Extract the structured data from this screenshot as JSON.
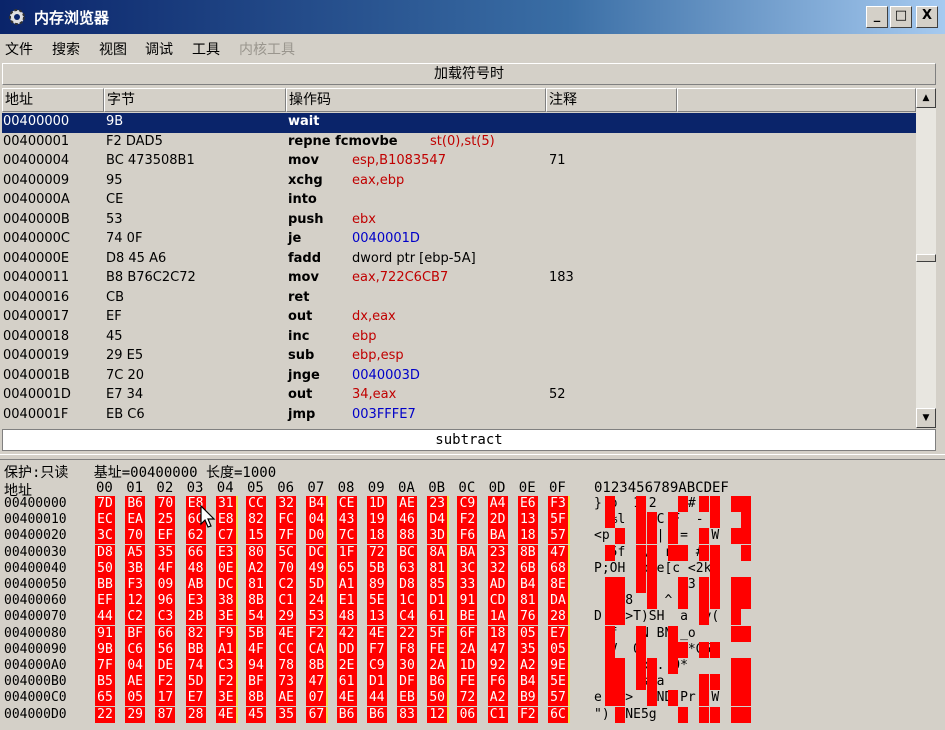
{
  "window": {
    "title": "内存浏览器",
    "min_label": "_",
    "max_label": "□",
    "close_label": "X"
  },
  "menu": [
    "文件",
    "搜索",
    "视图",
    "调试",
    "工具",
    "内核工具"
  ],
  "load_symbols_label": "加载符号时",
  "columns": [
    "地址",
    "字节",
    "操作码",
    "注释"
  ],
  "disasm": [
    {
      "addr": "00400000",
      "bytes": "9B",
      "op": "wait",
      "args": "",
      "cmt": "",
      "selected": true
    },
    {
      "addr": "00400001",
      "bytes": "F2 DAD5",
      "op": "repne fcmovbe",
      "args": "st(0),st(5)",
      "cmt": ""
    },
    {
      "addr": "00400004",
      "bytes": "BC 473508B1",
      "op": "mov",
      "args": "esp,B1083547",
      "cmt": "71"
    },
    {
      "addr": "00400009",
      "bytes": "95",
      "op": "xchg",
      "args": "eax,ebp",
      "cmt": ""
    },
    {
      "addr": "0040000A",
      "bytes": "CE",
      "op": "into",
      "args": "",
      "cmt": ""
    },
    {
      "addr": "0040000B",
      "bytes": "53",
      "op": "push",
      "args": "ebx",
      "cmt": ""
    },
    {
      "addr": "0040000C",
      "bytes": "74 0F",
      "op": "je",
      "args": "0040001D",
      "cmt": ""
    },
    {
      "addr": "0040000E",
      "bytes": "D8 45 A6",
      "op": "fadd",
      "args": "dword ptr [ebp-5A]",
      "cmt": ""
    },
    {
      "addr": "00400011",
      "bytes": "B8 B76C2C72",
      "op": "mov",
      "args": "eax,722C6CB7",
      "cmt": "183"
    },
    {
      "addr": "00400016",
      "bytes": "CB",
      "op": "ret",
      "args": "",
      "cmt": ""
    },
    {
      "addr": "00400017",
      "bytes": "EF",
      "op": "out",
      "args": "dx,eax",
      "cmt": ""
    },
    {
      "addr": "00400018",
      "bytes": "45",
      "op": "inc",
      "args": "ebp",
      "cmt": ""
    },
    {
      "addr": "00400019",
      "bytes": "29 E5",
      "op": "sub",
      "args": "ebp,esp",
      "cmt": ""
    },
    {
      "addr": "0040001B",
      "bytes": "7C 20",
      "op": "jnge",
      "args": "0040003D",
      "cmt": ""
    },
    {
      "addr": "0040001D",
      "bytes": "E7 34",
      "op": "out",
      "args": "34,eax",
      "cmt": "52"
    },
    {
      "addr": "0040001F",
      "bytes": "EB C6",
      "op": "jmp",
      "args": "003FFFE7",
      "cmt": ""
    }
  ],
  "subtract_label": "subtract",
  "hex_info": "保护:只读   基址=00400000 长度=1000",
  "hex_addr_label": "地址",
  "hex_cols": [
    "00",
    "01",
    "02",
    "03",
    "04",
    "05",
    "06",
    "07",
    "08",
    "09",
    "0A",
    "0B",
    "0C",
    "0D",
    "0E",
    "0F"
  ],
  "hex_ascii_header": "0123456789ABCDEF",
  "hex_rows": [
    {
      "addr": "00400000",
      "bytes": [
        "7D",
        "B6",
        "70",
        "E8",
        "31",
        "CC",
        "32",
        "B4",
        "CE",
        "1D",
        "AE",
        "23",
        "C9",
        "A4",
        "E6",
        "F3"
      ],
      "ascii": "} p  1 2    #    "
    },
    {
      "addr": "00400010",
      "bytes": [
        "EC",
        "EA",
        "25",
        "6C",
        "E8",
        "82",
        "FC",
        "04",
        "43",
        "19",
        "46",
        "D4",
        "F2",
        "2D",
        "13",
        "5F"
      ],
      "ascii": "  %l    C F  -  "
    },
    {
      "addr": "00400020",
      "bytes": [
        "3C",
        "70",
        "EF",
        "62",
        "C7",
        "15",
        "7F",
        "D0",
        "7C",
        "18",
        "88",
        "3D",
        "F6",
        "BA",
        "18",
        "57"
      ],
      "ascii": "<p b    |  =   W"
    },
    {
      "addr": "00400030",
      "bytes": [
        "D8",
        "A5",
        "35",
        "66",
        "E3",
        "80",
        "5C",
        "DC",
        "1F",
        "72",
        "BC",
        "8A",
        "BA",
        "23",
        "8B",
        "47"
      ],
      "ascii": "  5f  \\  r   # G"
    },
    {
      "addr": "00400040",
      "bytes": [
        "50",
        "3B",
        "4F",
        "48",
        "0E",
        "A2",
        "70",
        "49",
        "65",
        "5B",
        "63",
        "81",
        "3C",
        "32",
        "6B",
        "68"
      ],
      "ascii": "P;OH  pIe[c <2kh"
    },
    {
      "addr": "00400050",
      "bytes": [
        "BB",
        "F3",
        "09",
        "AB",
        "DC",
        "81",
        "C2",
        "5D",
        "A1",
        "89",
        "D8",
        "85",
        "33",
        "AD",
        "B4",
        "8E"
      ],
      "ascii": "       ]    3   "
    },
    {
      "addr": "00400060",
      "bytes": [
        "EF",
        "12",
        "96",
        "E3",
        "38",
        "8B",
        "C1",
        "24",
        "E1",
        "5E",
        "1C",
        "D1",
        "91",
        "CD",
        "81",
        "DA"
      ],
      "ascii": "    8  $ ^      "
    },
    {
      "addr": "00400070",
      "bytes": [
        "44",
        "C2",
        "C3",
        "2B",
        "3E",
        "54",
        "29",
        "53",
        "48",
        "13",
        "C4",
        "61",
        "BE",
        "1A",
        "76",
        "28"
      ],
      "ascii": "D  +>T)SH  a  v("
    },
    {
      "addr": "00400080",
      "bytes": [
        "91",
        "BF",
        "66",
        "82",
        "F9",
        "5B",
        "4E",
        "F2",
        "42",
        "4E",
        "22",
        "5F",
        "6F",
        "18",
        "05",
        "E7"
      ],
      "ascii": "  f  [N BN\"_o   "
    },
    {
      "addr": "00400090",
      "bytes": [
        "9B",
        "C6",
        "56",
        "BB",
        "A1",
        "4F",
        "CC",
        "CA",
        "DD",
        "F7",
        "F8",
        "FE",
        "2A",
        "47",
        "35",
        "05"
      ],
      "ascii": "  V  O      *G5 "
    },
    {
      "addr": "004000A0",
      "bytes": [
        "7F",
        "04",
        "DE",
        "74",
        "C3",
        "94",
        "78",
        "8B",
        "2E",
        "C9",
        "30",
        "2A",
        "1D",
        "92",
        "A2",
        "9E"
      ],
      "ascii": "   t  x . 0*    "
    },
    {
      "addr": "004000B0",
      "bytes": [
        "B5",
        "AE",
        "F2",
        "5D",
        "F2",
        "BF",
        "73",
        "47",
        "61",
        "D1",
        "DF",
        "B6",
        "FE",
        "F6",
        "B4",
        "5E"
      ],
      "ascii": "   ]  sGa      ^"
    },
    {
      "addr": "004000C0",
      "bytes": [
        "65",
        "05",
        "17",
        "E7",
        "3E",
        "8B",
        "AE",
        "07",
        "4E",
        "44",
        "EB",
        "50",
        "72",
        "A2",
        "B9",
        "57"
      ],
      "ascii": "e   >   ND Pr  W"
    },
    {
      "addr": "004000D0",
      "bytes": [
        "22",
        "29",
        "87",
        "28",
        "4E",
        "45",
        "35",
        "67",
        "B6",
        "B6",
        "83",
        "12",
        "06",
        "C1",
        "F2",
        "6C"
      ],
      "ascii": "\") (NE5g       l"
    }
  ]
}
